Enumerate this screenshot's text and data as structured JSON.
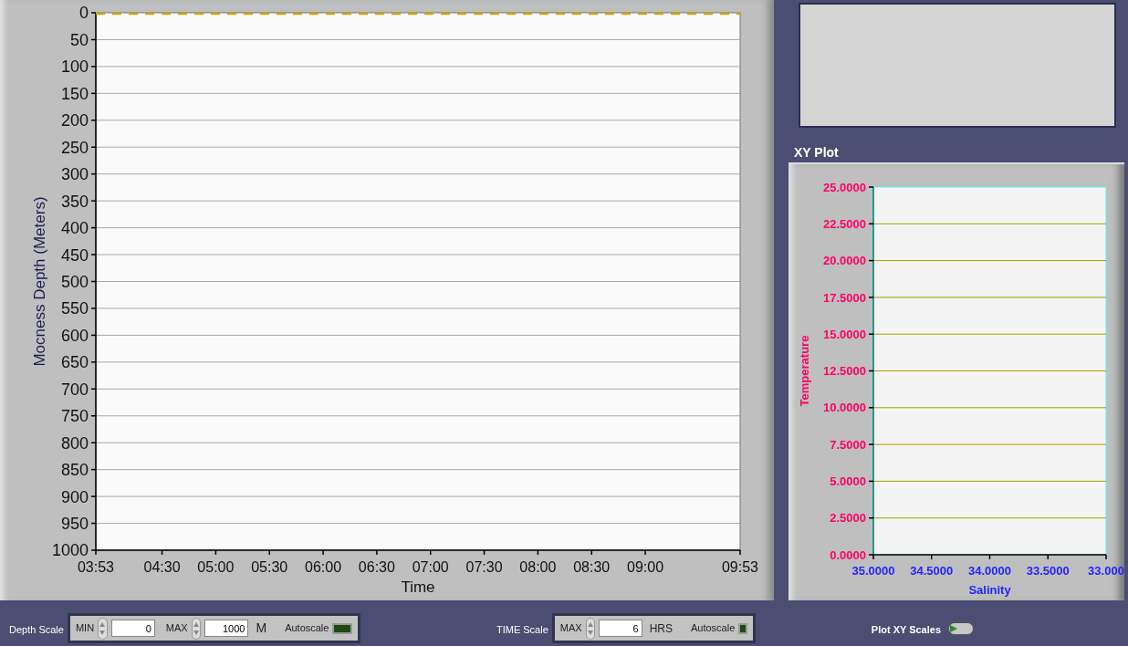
{
  "depth_chart": {
    "chart_data": {
      "type": "line",
      "xlabel": "Time",
      "ylabel": "Mocness Depth (Meters)",
      "xlim": [
        233,
        593
      ],
      "ylim": [
        1000,
        0
      ],
      "grid": true,
      "xticks": [
        {
          "value": 233,
          "label": "03:53"
        },
        {
          "value": 270,
          "label": "04:30"
        },
        {
          "value": 300,
          "label": "05:00"
        },
        {
          "value": 330,
          "label": "05:30"
        },
        {
          "value": 360,
          "label": "06:00"
        },
        {
          "value": 390,
          "label": "06:30"
        },
        {
          "value": 420,
          "label": "07:00"
        },
        {
          "value": 450,
          "label": "07:30"
        },
        {
          "value": 480,
          "label": "08:00"
        },
        {
          "value": 510,
          "label": "08:30"
        },
        {
          "value": 540,
          "label": "09:00"
        },
        {
          "value": 593,
          "label": "09:53"
        }
      ],
      "yticks": [
        0,
        50,
        100,
        150,
        200,
        250,
        300,
        350,
        400,
        450,
        500,
        550,
        600,
        650,
        700,
        750,
        800,
        850,
        900,
        950,
        1000
      ],
      "x": [
        233,
        593
      ],
      "series": [
        {
          "color": "#c8a800",
          "line_style": "dashed",
          "values": [
            0,
            0
          ]
        }
      ]
    }
  },
  "xy_plot": {
    "title": "XY Plot",
    "chart_data": {
      "type": "scatter",
      "xlabel": "Salinity",
      "ylabel": "Temperature",
      "xlim": [
        35,
        33
      ],
      "ylim": [
        0,
        25
      ],
      "grid": true,
      "xticks": [
        {
          "value": 35,
          "label": "35.0000"
        },
        {
          "value": 34.5,
          "label": "34.5000"
        },
        {
          "value": 34,
          "label": "34.0000"
        },
        {
          "value": 33.5,
          "label": "33.5000"
        },
        {
          "value": 33,
          "label": "33.000"
        }
      ],
      "yticks": [
        {
          "value": 0,
          "label": "0.0000"
        },
        {
          "value": 2.5,
          "label": "2.5000"
        },
        {
          "value": 5,
          "label": "5.0000"
        },
        {
          "value": 7.5,
          "label": "7.5000"
        },
        {
          "value": 10,
          "label": "10.0000"
        },
        {
          "value": 12.5,
          "label": "12.5000"
        },
        {
          "value": 15,
          "label": "15.0000"
        },
        {
          "value": 17.5,
          "label": "17.5000"
        },
        {
          "value": 20,
          "label": "20.0000"
        },
        {
          "value": 22.5,
          "label": "22.5000"
        },
        {
          "value": 25,
          "label": "25.0000"
        }
      ]
    }
  },
  "depth_scale": {
    "label": "Depth Scale",
    "min_label": "MIN",
    "min_value": "0",
    "max_label": "MAX",
    "max_value": "1000",
    "unit": "M",
    "autoscale_label": "Autoscale",
    "autoscale_on": false
  },
  "time_scale": {
    "label": "TIME Scale",
    "max_label": "MAX",
    "max_value": "6",
    "unit": "HRS",
    "autoscale_label": "Autoscale",
    "autoscale_on": false
  },
  "plot_xy_scales": {
    "label": "Plot XY Scales",
    "on": false
  }
}
